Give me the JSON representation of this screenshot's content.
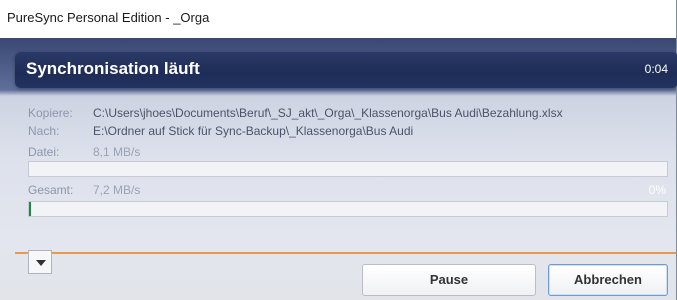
{
  "window": {
    "title": "PureSync Personal Edition  -  _Orga"
  },
  "header": {
    "title": "Synchronisation läuft",
    "elapsed": "0:04"
  },
  "details": {
    "copy_label": "Kopiere:",
    "copy_value": "C:\\Users\\jhoes\\Documents\\Beruf\\_SJ_akt\\_Orga\\_Klassenorga\\Bus Audi\\Bezahlung.xlsx",
    "dest_label": "Nach:",
    "dest_value": "E:\\Ordner auf Stick für Sync-Backup\\_Klassenorga\\Bus Audi",
    "file_label": "Datei:",
    "file_speed": "8,1 MB/s",
    "total_label": "Gesamt:",
    "total_speed": "7,2 MB/s",
    "total_percent": "0%"
  },
  "progress": {
    "file": 0,
    "total": 0.003
  },
  "buttons": {
    "pause": "Pause",
    "cancel": "Abbrechen"
  },
  "icons": {
    "menu": "chevron-down-icon"
  },
  "colors": {
    "header": "#1e2c57",
    "progress": "#1f8a3a",
    "accent_line": "#e89a4a"
  }
}
